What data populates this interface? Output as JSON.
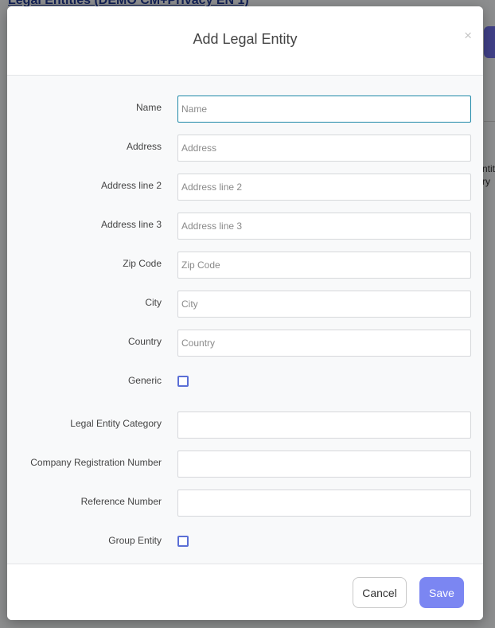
{
  "background": {
    "page_title": "Legal Entities (DEMO CM+Privacy EN 1)",
    "side_text_1": "ntit",
    "side_text_2": "ry"
  },
  "modal": {
    "title": "Add Legal Entity",
    "close_glyph": "×",
    "fields": {
      "name": {
        "label": "Name",
        "placeholder": "Name",
        "value": ""
      },
      "address": {
        "label": "Address",
        "placeholder": "Address",
        "value": ""
      },
      "address_line_2": {
        "label": "Address line 2",
        "placeholder": "Address line 2",
        "value": ""
      },
      "address_line_3": {
        "label": "Address line 3",
        "placeholder": "Address line 3",
        "value": ""
      },
      "zip_code": {
        "label": "Zip Code",
        "placeholder": "Zip Code",
        "value": ""
      },
      "city": {
        "label": "City",
        "placeholder": "City",
        "value": ""
      },
      "country": {
        "label": "Country",
        "placeholder": "Country",
        "value": ""
      },
      "generic": {
        "label": "Generic",
        "checked": false
      },
      "legal_entity_category": {
        "label": "Legal Entity Category",
        "placeholder": "",
        "value": ""
      },
      "company_registration_number": {
        "label": "Company Registration Number",
        "placeholder": "",
        "value": ""
      },
      "reference_number": {
        "label": "Reference Number",
        "placeholder": "",
        "value": ""
      },
      "group_entity": {
        "label": "Group Entity",
        "checked": false
      }
    },
    "footer": {
      "cancel_label": "Cancel",
      "save_label": "Save"
    }
  },
  "colors": {
    "accent": "#7b86f2",
    "focus_border": "#1e88a8",
    "checkbox_border": "#5b6fd6"
  }
}
